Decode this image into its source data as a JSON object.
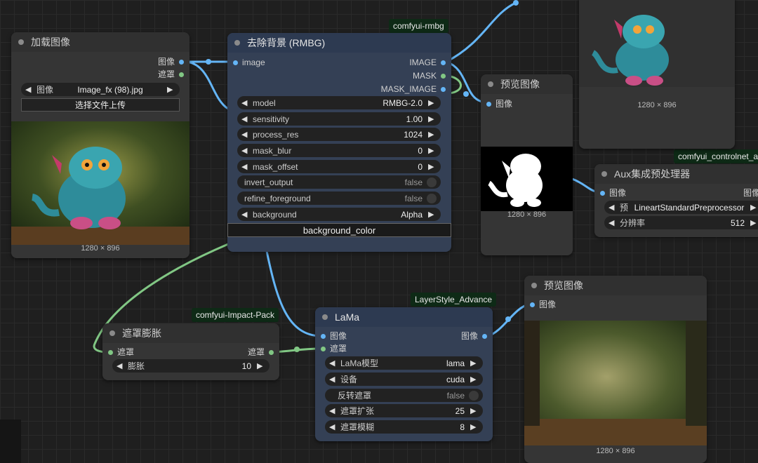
{
  "tags": {
    "rmbg": "comfyui-rmbg",
    "controlnet": "comfyui_controlnet_a",
    "impact": "comfyui-Impact-Pack",
    "layerstyle": "LayerStyle_Advance"
  },
  "load_image": {
    "title": "加载图像",
    "out_image": "图像",
    "out_mask": "遮罩",
    "image_label": "图像",
    "image_value": "Image_fx (98).jpg",
    "upload_label": "选择文件上传",
    "caption": "1280 × 896"
  },
  "rmbg": {
    "title": "去除背景 (RMBG)",
    "in_image": "image",
    "out_image": "IMAGE",
    "out_mask": "MASK",
    "out_mask_image": "MASK_IMAGE",
    "widgets": [
      {
        "label": "model",
        "value": "RMBG-2.0"
      },
      {
        "label": "sensitivity",
        "value": "1.00"
      },
      {
        "label": "process_res",
        "value": "1024"
      },
      {
        "label": "mask_blur",
        "value": "0"
      },
      {
        "label": "mask_offset",
        "value": "0"
      },
      {
        "label": "invert_output",
        "value": "false"
      },
      {
        "label": "refine_foreground",
        "value": "false"
      },
      {
        "label": "background",
        "value": "Alpha"
      }
    ],
    "bg_color": "background_color"
  },
  "preview_top": {
    "caption": "1280 × 896"
  },
  "preview_mid": {
    "title": "预览图像",
    "in_image": "图像",
    "caption": "1280 × 896"
  },
  "aux": {
    "title": "Aux集成预处理器",
    "in_image": "图像",
    "out_image": "图像",
    "pre_label": "预",
    "pre_value": "LineartStandardPreprocessor",
    "res_label": "分辨率",
    "res_value": "512"
  },
  "dilate": {
    "title": "遮罩膨胀",
    "in_mask": "遮罩",
    "out_mask": "遮罩",
    "w_label": "膨胀",
    "w_value": "10"
  },
  "lama": {
    "title": "LaMa",
    "in_image": "图像",
    "in_mask": "遮罩",
    "out_image": "图像",
    "widgets": [
      {
        "label": "LaMa模型",
        "value": "lama"
      },
      {
        "label": "设备",
        "value": "cuda"
      },
      {
        "label": "反转遮罩",
        "value": "false"
      },
      {
        "label": "遮罩扩张",
        "value": "25"
      },
      {
        "label": "遮罩模糊",
        "value": "8"
      }
    ]
  },
  "preview_bottom": {
    "title": "预览图像",
    "in_image": "图像",
    "caption": "1280 × 896"
  },
  "colors": {
    "image_wire": "#64b5f6",
    "mask_wire": "#81c784",
    "node_bg": "#353535",
    "node_blue": "#344055"
  }
}
